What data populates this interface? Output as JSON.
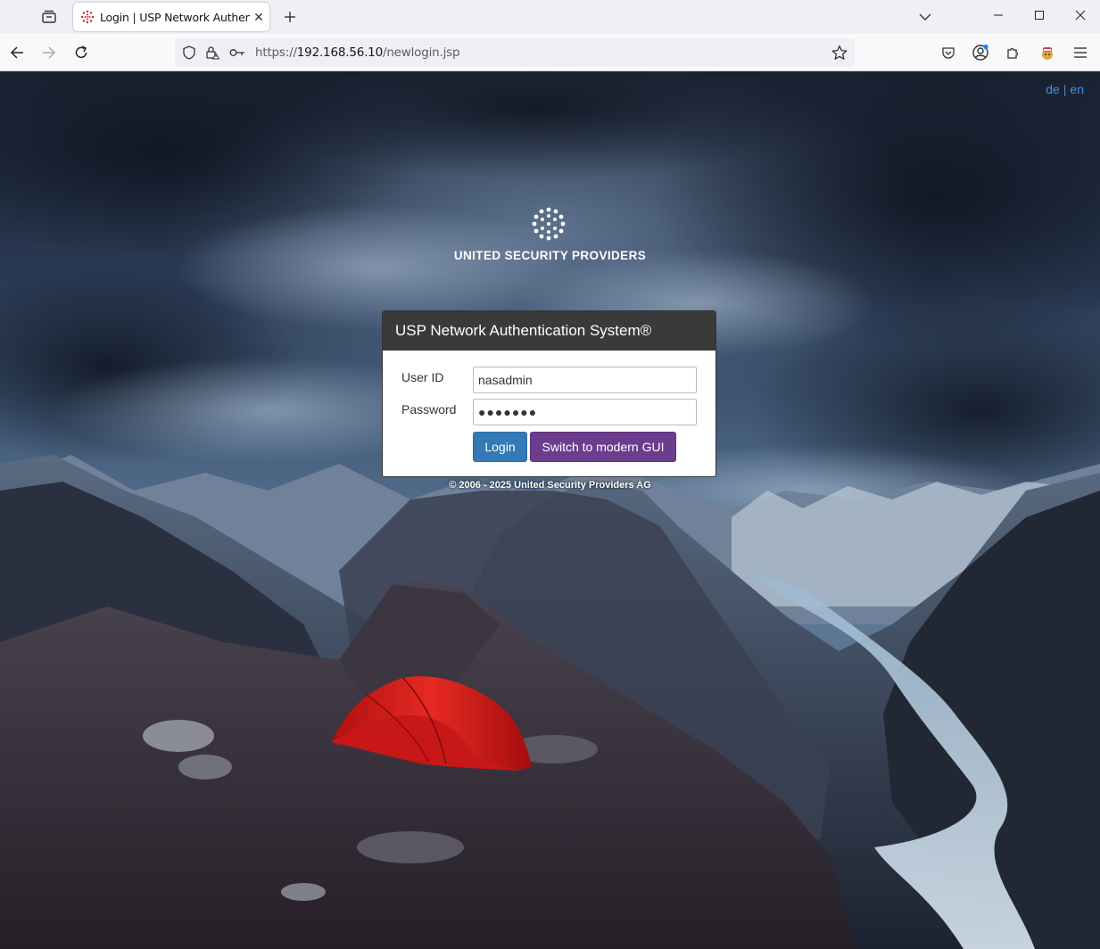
{
  "browser": {
    "tab_title": "Login | USP Network Authenticati",
    "url_scheme": "https://",
    "url_host": "192.168.56.10",
    "url_path": "/newlogin.jsp"
  },
  "page": {
    "lang": {
      "de": "de",
      "sep": "|",
      "en": "en"
    },
    "brand": "UNITED SECURITY PROVIDERS",
    "panel_title": "USP Network Authentication System®",
    "form": {
      "user_label": "User ID",
      "user_value": "nasadmin",
      "password_label": "Password",
      "password_value": "●●●●●●●",
      "login_label": "Login",
      "modern_label": "Switch to modern GUI"
    },
    "copyright": "© 2006 - 2025 United Security Providers AG"
  },
  "colors": {
    "login_button": "#337ab7",
    "modern_button": "#6a3d8e",
    "panel_header": "#3a3a3a",
    "tent": "#d41e1e"
  }
}
